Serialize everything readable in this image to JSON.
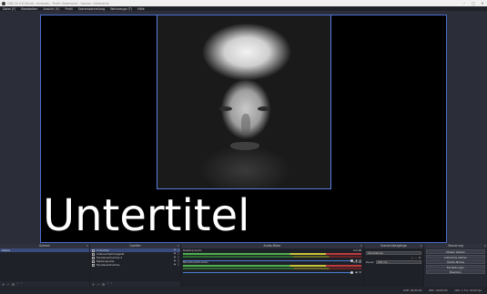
{
  "window": {
    "title": "OBS 25.0.8 (64-bit, windows) - Profil: Unbenannt - Szenen: Unbenannt"
  },
  "menu": [
    "Datei (F)",
    "Bearbeiten",
    "Ansicht (V)",
    "Profil",
    "Szenensammlung",
    "Werkzeuge (T)",
    "Hilfe"
  ],
  "preview": {
    "subtitle_text": "Untertitel"
  },
  "docks": {
    "scenes": {
      "title": "Szenen",
      "items": [
        "Szene"
      ]
    },
    "sources": {
      "title": "Quellen",
      "items": [
        {
          "name": "Untertitel",
          "icon": "text-icon"
        },
        {
          "name": "Videoaufnahmegerät",
          "icon": "camera-icon"
        },
        {
          "name": "Fensteraufnahme 2",
          "icon": "window-icon"
        },
        {
          "name": "Medienquelle",
          "icon": "media-icon"
        },
        {
          "name": "Fensteraufnahme",
          "icon": "window-icon"
        }
      ]
    },
    "mixer": {
      "title": "Audio-Mixer",
      "channels": [
        {
          "name": "Desktop-Audio",
          "db": "0.0 dB"
        },
        {
          "name": "Mikrofon/AUX-Audio",
          "db": "0.0 dB"
        }
      ]
    },
    "transitions": {
      "title": "Szenenübergänge",
      "type": "Überblende",
      "duration_label": "Dauer",
      "duration_value": "300 ms"
    },
    "controls": {
      "title": "Steuerung",
      "buttons": [
        "Stream starten",
        "Aufnahme starten",
        "Studio-Modus",
        "Einstellungen",
        "Beenden"
      ]
    }
  },
  "status": {
    "live": "LIVE: 00:00:00",
    "rec": "REC: 00:00:00",
    "cpu": "CPU: 1.7%, 30.00 fps"
  },
  "colors": {
    "accent": "#4b6fd1",
    "background": "#2b2e38",
    "panel": "#1f2128"
  }
}
